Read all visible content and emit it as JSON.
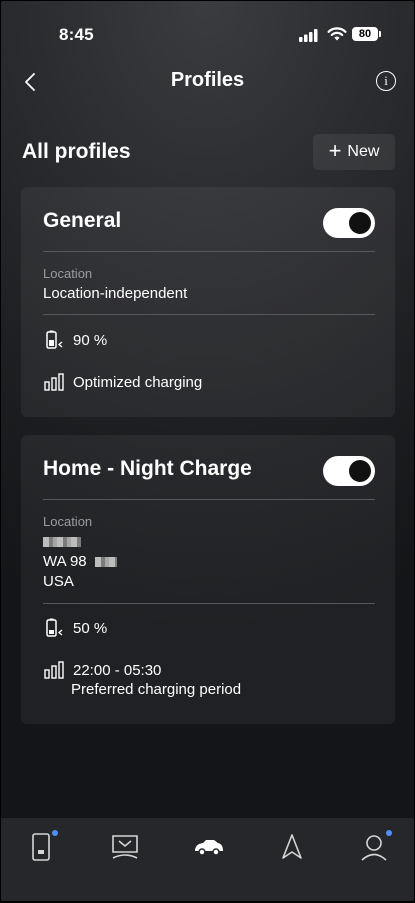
{
  "status_bar": {
    "time": "8:45",
    "battery": "80"
  },
  "header": {
    "title": "Profiles"
  },
  "section": {
    "title": "All profiles",
    "new_button": "New"
  },
  "profiles": [
    {
      "name": "General",
      "enabled": true,
      "location_label": "Location",
      "location_value": "Location-independent",
      "target_charge": "90 %",
      "charging_mode": "Optimized charging"
    },
    {
      "name": "Home - Night Charge",
      "enabled": true,
      "location_label": "Location",
      "address_line2": "WA 98",
      "address_line3": "USA",
      "target_charge": "50 %",
      "charging_period": "22:00 - 05:30",
      "charging_period_label": "Preferred charging period"
    }
  ],
  "tabbar": {
    "items": [
      "phone-card-icon",
      "charging-station-icon",
      "car-icon",
      "navigation-arrow-icon",
      "profile-icon"
    ],
    "active_index": 2,
    "badge_color": "#4f8fff"
  }
}
